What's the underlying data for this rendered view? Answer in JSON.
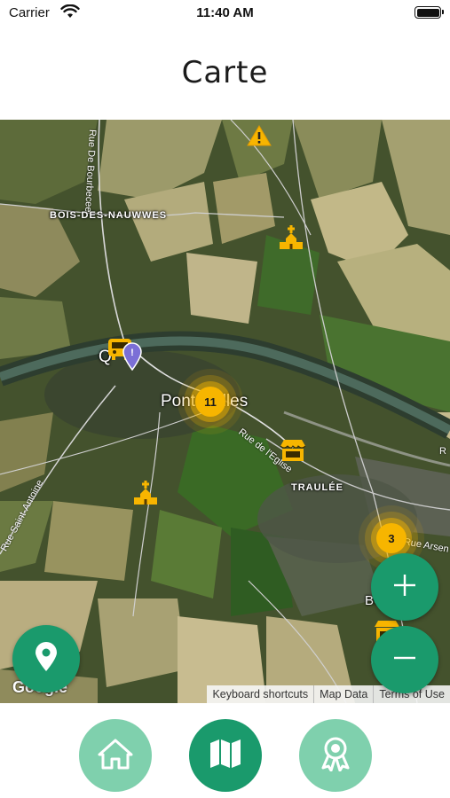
{
  "status_bar": {
    "carrier": "Carrier",
    "time": "11:40 AM"
  },
  "header": {
    "title": "Carte"
  },
  "map": {
    "places": {
      "bois_des_nauwwes": "BOIS-DES-NAUWWES",
      "pont_a_celles": "Pont-Celles",
      "traulee": "TRAULÉE",
      "q": "Q",
      "bo_aud": "BO    AUD"
    },
    "streets": {
      "rue_de_bourbecee": "Rue De Bourbecee",
      "rue_saint_antoine": "Rue Saint-Antoine",
      "rue_de_l_eglise": "Rue de l'Eglise",
      "rue_arsenal": "Rue Arsen",
      "r_right": "R"
    },
    "clusters": {
      "center": "11",
      "east": "3"
    },
    "markers": [
      "warning-marker",
      "church-marker",
      "church-marker",
      "shop-marker",
      "shop-marker",
      "tram-marker",
      "location-pin"
    ],
    "google_logo": "Google",
    "attribution": {
      "keyboard_shortcuts": "Keyboard shortcuts",
      "map_data": "Map Data",
      "terms": "Terms of Use"
    },
    "colors": {
      "cluster": "#f7b500",
      "fab": "#1a9a6c"
    }
  },
  "controls": {
    "zoom_in": "+",
    "zoom_out": "−",
    "my_location": "location-icon"
  },
  "nav": {
    "items": [
      {
        "icon": "home-icon",
        "active": false
      },
      {
        "icon": "map-icon",
        "active": true
      },
      {
        "icon": "badge-icon",
        "active": false
      }
    ],
    "colors": {
      "active": "#1a9a6c",
      "inactive": "#7fd0ad"
    }
  }
}
